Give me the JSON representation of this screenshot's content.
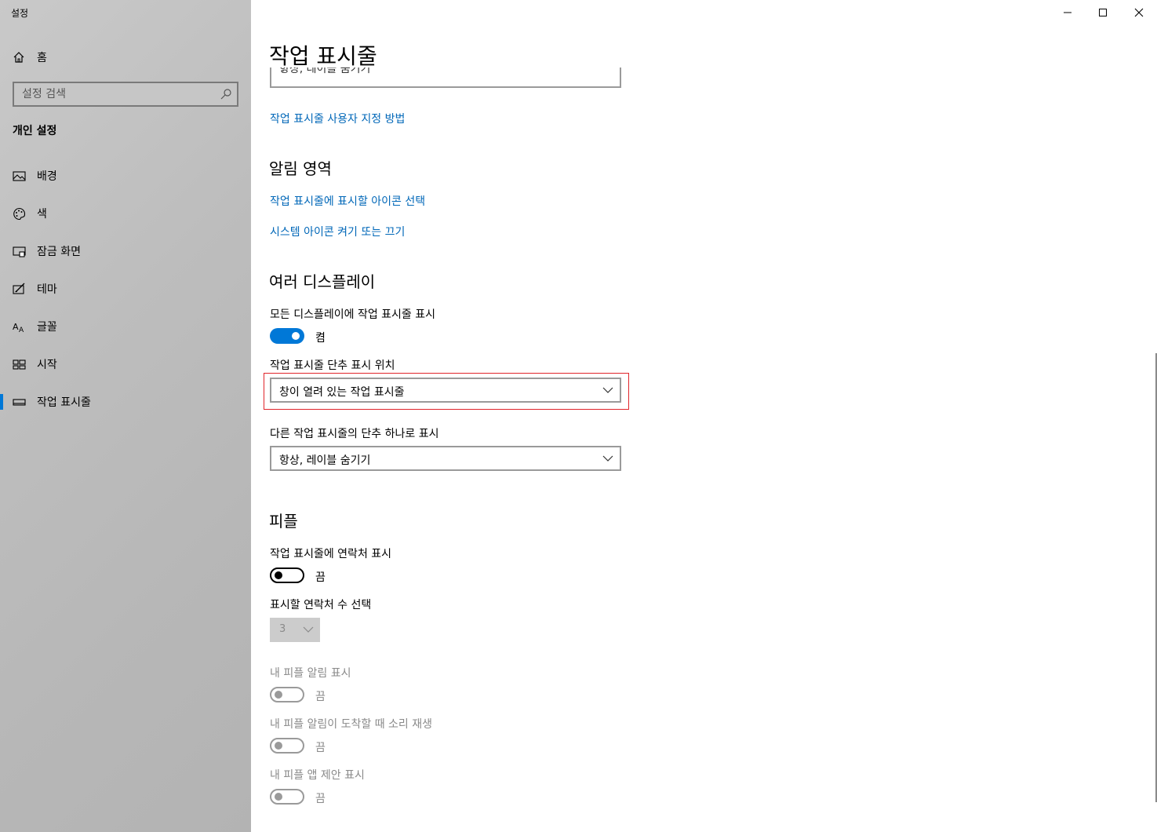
{
  "window": {
    "app_title": "설정",
    "minimize_icon": "minimize-icon",
    "maximize_icon": "maximize-icon",
    "close_icon": "close-icon"
  },
  "sidebar": {
    "home_label": "홈",
    "search_placeholder": "설정 검색",
    "section_title": "개인 설정",
    "items": [
      {
        "label": "배경",
        "icon": "picture-icon"
      },
      {
        "label": "색",
        "icon": "palette-icon"
      },
      {
        "label": "잠금 화면",
        "icon": "lock-screen-icon"
      },
      {
        "label": "테마",
        "icon": "theme-icon"
      },
      {
        "label": "글꼴",
        "icon": "font-icon"
      },
      {
        "label": "시작",
        "icon": "start-icon"
      },
      {
        "label": "작업 표시줄",
        "icon": "taskbar-icon",
        "active": true
      }
    ],
    "accent_color": "#0078d7"
  },
  "main": {
    "page_title": "작업 표시줄",
    "partial_dropdown_value": "항상, 레이블 숨기기",
    "customize_link": "작업 표시줄 사용자 지정 방법",
    "notification_area": {
      "heading": "알림 영역",
      "link_select_icons": "작업 표시줄에 표시할 아이콘 선택",
      "link_system_icons": "시스템 아이콘 켜기 또는 끄기"
    },
    "multiple_displays": {
      "heading": "여러 디스플레이",
      "show_all_label": "모든 디스플레이에 작업 표시줄 표시",
      "show_all_state": "켬",
      "buttons_position_label": "작업 표시줄 단추 표시 위치",
      "buttons_position_value": "창이 열려 있는 작업 표시줄",
      "combine_label": "다른 작업 표시줄의 단추 하나로 표시",
      "combine_value": "항상, 레이블 숨기기"
    },
    "people": {
      "heading": "피플",
      "show_contacts_label": "작업 표시줄에 연락처 표시",
      "show_contacts_state": "끔",
      "contact_count_label": "표시할 연락처 수 선택",
      "contact_count_value": "3",
      "show_notifications_label": "내 피플 알림 표시",
      "show_notifications_state": "끔",
      "play_sound_label": "내 피플 알림이 도착할 때 소리 재생",
      "play_sound_state": "끔",
      "show_suggestions_label": "내 피플 앱 제안 표시",
      "show_suggestions_state": "끔"
    },
    "link_color": "#0067b8",
    "highlight_color": "#e0252b"
  }
}
